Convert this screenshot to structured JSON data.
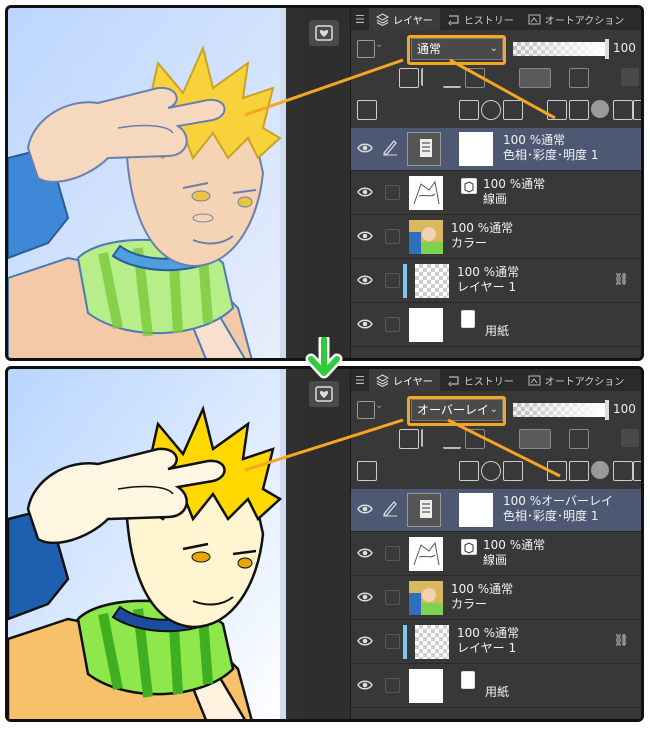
{
  "tabs": [
    {
      "label": "レイヤー",
      "icon": "layers-icon"
    },
    {
      "label": "ヒストリー",
      "icon": "history-icon"
    },
    {
      "label": "オートアクション",
      "icon": "auto-action-icon"
    }
  ],
  "top_panel": {
    "blend_mode": "通常",
    "opacity": "100",
    "layers": [
      {
        "name": "色相･彩度･明度 1",
        "meta": "100 %通常",
        "type": "correction"
      },
      {
        "name": "線画",
        "meta": "100 %通常",
        "type": "vector"
      },
      {
        "name": "カラー",
        "meta": "100 %通常",
        "type": "raster"
      },
      {
        "name": "レイヤー 1",
        "meta": "100 %通常",
        "type": "raster"
      },
      {
        "name": "用紙",
        "meta": "",
        "type": "paper"
      }
    ]
  },
  "bottom_panel": {
    "blend_mode": "オーバーレイ",
    "opacity": "100",
    "layers": [
      {
        "name": "色相･彩度･明度 1",
        "meta": "100 %オーバーレイ",
        "type": "correction"
      },
      {
        "name": "線画",
        "meta": "100 %通常",
        "type": "vector"
      },
      {
        "name": "カラー",
        "meta": "100 %通常",
        "type": "raster"
      },
      {
        "name": "レイヤー 1",
        "meta": "100 %通常",
        "type": "raster"
      },
      {
        "name": "用紙",
        "meta": "",
        "type": "paper"
      }
    ]
  },
  "colors": {
    "highlight": "#f5a623",
    "arrow": "#2ecc3a",
    "selected_row": "#4d5873"
  }
}
